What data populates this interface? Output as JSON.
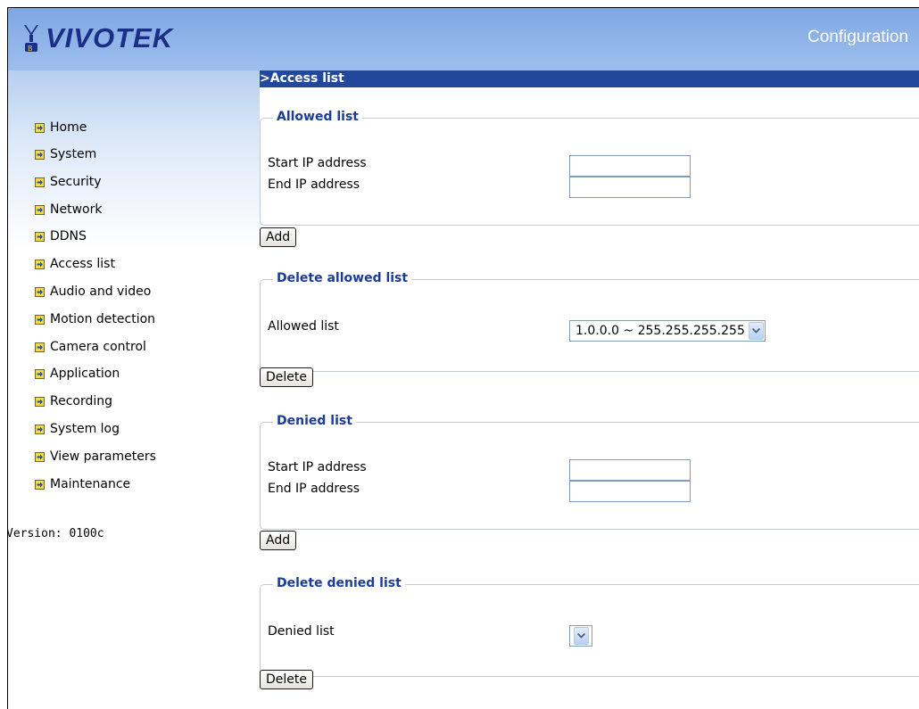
{
  "header": {
    "logo_text": "VIVOTEK",
    "title": "Configuration"
  },
  "sidebar": {
    "items": [
      {
        "label": "Home"
      },
      {
        "label": "System"
      },
      {
        "label": "Security"
      },
      {
        "label": "Network"
      },
      {
        "label": "DDNS"
      },
      {
        "label": "Access list"
      },
      {
        "label": "Audio and video"
      },
      {
        "label": "Motion detection"
      },
      {
        "label": "Camera control"
      },
      {
        "label": "Application"
      },
      {
        "label": "Recording"
      },
      {
        "label": "System log"
      },
      {
        "label": "View parameters"
      },
      {
        "label": "Maintenance"
      }
    ],
    "version": "Version: 0100c"
  },
  "main": {
    "section_title": ">Access list",
    "allowed": {
      "legend": "Allowed list",
      "start_label": "Start IP address",
      "end_label": "End IP address",
      "start_value": "",
      "end_value": "",
      "add_label": "Add"
    },
    "delete_allowed": {
      "legend": "Delete allowed list",
      "list_label": "Allowed list",
      "selected": "1.0.0.0 ~ 255.255.255.255",
      "delete_label": "Delete"
    },
    "denied": {
      "legend": "Denied list",
      "start_label": "Start IP address",
      "end_label": "End IP address",
      "start_value": "",
      "end_value": "",
      "add_label": "Add"
    },
    "delete_denied": {
      "legend": "Delete denied list",
      "list_label": "Denied list",
      "selected": "",
      "delete_label": "Delete"
    }
  },
  "colors": {
    "header_gradient_top": "#7fa7e2",
    "section_bar": "#22489b",
    "legend_text": "#1c3c99",
    "nav_icon": "#2a4fa8"
  },
  "icons": {
    "nav_bullet": "arrow-right-icon",
    "select_arrow": "chevron-down-icon"
  }
}
